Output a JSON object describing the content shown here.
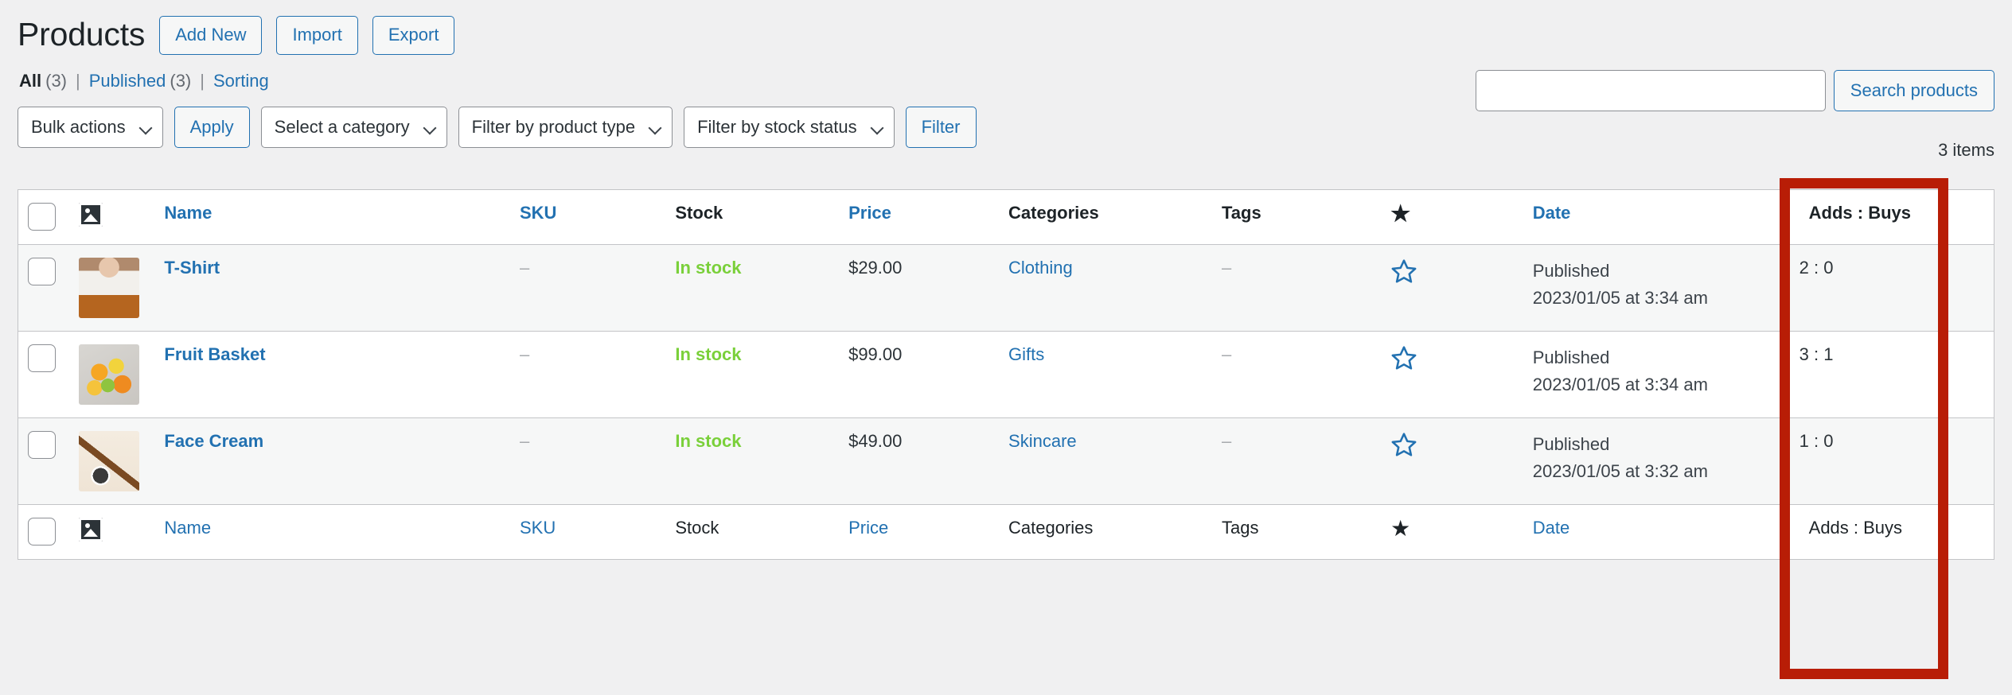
{
  "header": {
    "title": "Products",
    "actions": [
      {
        "label": "Add New",
        "name": "add-new-button"
      },
      {
        "label": "Import",
        "name": "import-button"
      },
      {
        "label": "Export",
        "name": "export-button"
      }
    ]
  },
  "views": {
    "all_label": "All",
    "all_count": "(3)",
    "published_label": "Published",
    "published_count": "(3)",
    "sorting_label": "Sorting",
    "separator": "|"
  },
  "search": {
    "value": "",
    "placeholder": "",
    "button_label": "Search products"
  },
  "tablenav": {
    "bulk_actions_label": "Bulk actions",
    "apply_label": "Apply",
    "category_label": "Select a category",
    "product_type_label": "Filter by product type",
    "stock_status_label": "Filter by stock status",
    "filter_label": "Filter",
    "items_count": "3 items"
  },
  "table": {
    "columns": {
      "image": "image-icon",
      "name": "Name",
      "sku": "SKU",
      "stock": "Stock",
      "price": "Price",
      "categories": "Categories",
      "tags": "Tags",
      "featured": "star-icon",
      "date": "Date",
      "adds_buys": "Adds : Buys"
    },
    "rows": [
      {
        "thumb_class": "thumb-tshirt",
        "name": "T-Shirt",
        "sku": "–",
        "stock": "In stock",
        "price": "$29.00",
        "category": "Clothing",
        "tags": "–",
        "featured": "star-outline-icon",
        "date_status": "Published",
        "date_value": "2023/01/05 at 3:34 am",
        "adds_buys": "2 : 0"
      },
      {
        "thumb_class": "thumb-fruit",
        "name": "Fruit Basket",
        "sku": "–",
        "stock": "In stock",
        "price": "$99.00",
        "category": "Gifts",
        "tags": "–",
        "featured": "star-outline-icon",
        "date_status": "Published",
        "date_value": "2023/01/05 at 3:34 am",
        "adds_buys": "3 : 1"
      },
      {
        "thumb_class": "thumb-cream",
        "name": "Face Cream",
        "sku": "–",
        "stock": "In stock",
        "price": "$49.00",
        "category": "Skincare",
        "tags": "–",
        "featured": "star-outline-icon",
        "date_status": "Published",
        "date_value": "2023/01/05 at 3:32 am",
        "adds_buys": "1 : 0"
      }
    ]
  },
  "annotation": {
    "color": "#b81d06",
    "target": "adds-buys-column"
  },
  "colors": {
    "link": "#2271b1",
    "in_stock": "#7ad03a",
    "text": "#1d2327",
    "muted": "#646970",
    "page_bg": "#f0f0f1",
    "row_alt_bg": "#f6f7f7",
    "border": "#c3c4c7",
    "annotation_red": "#b81d06"
  }
}
